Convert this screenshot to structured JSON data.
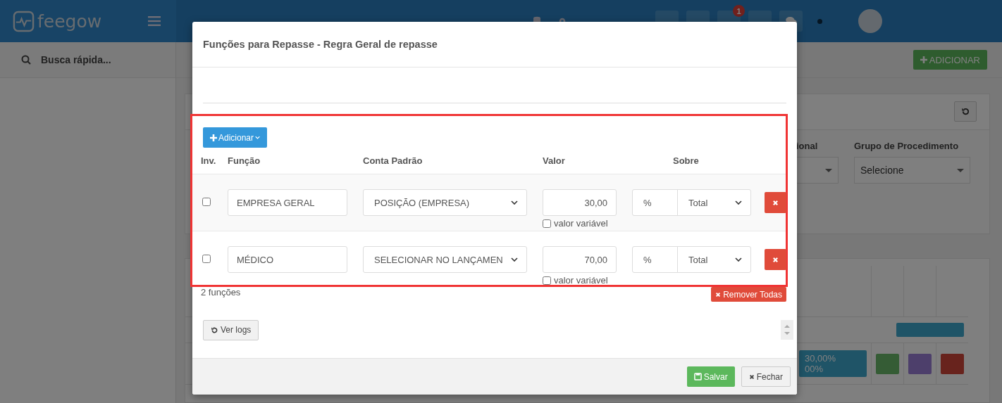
{
  "header": {
    "logo": "feegow",
    "notification_badge": "1"
  },
  "sidebar": {
    "search": {
      "placeholder": "Busca rápida..."
    }
  },
  "main": {
    "add_button": "ADICIONAR",
    "filters": [
      {
        "label": "ional"
      },
      {
        "label": "Grupo de Procedimento",
        "value": "Selecione"
      }
    ],
    "table_rows": [
      {
        "lines": []
      },
      {
        "lines": [
          "30,00%",
          "00%"
        ]
      }
    ]
  },
  "modal": {
    "title": "Funções para Repasse - Regra Geral de repasse",
    "add_button": "Adicionar",
    "columns": [
      "Inv.",
      "Função",
      "Conta Padrão",
      "Valor",
      "Sobre"
    ],
    "rows": [
      {
        "inverted": false,
        "function": "EMPRESA GERAL",
        "account": "POSIÇÃO (EMPRESA)",
        "value": "30,00",
        "variable_label": "valor variável",
        "variable": false,
        "unit": "%",
        "base": "Total"
      },
      {
        "inverted": false,
        "function": "MÉDICO",
        "account": "SELECIONAR NO LANÇAMEN",
        "value": "70,00",
        "variable_label": "valor variável",
        "variable": false,
        "unit": "%",
        "base": "Total"
      }
    ],
    "count": "2 funções",
    "remove_all": "Remover Todas",
    "logs_button": "Ver logs",
    "buttons": {
      "save": "Salvar",
      "close": "Fechar"
    }
  }
}
